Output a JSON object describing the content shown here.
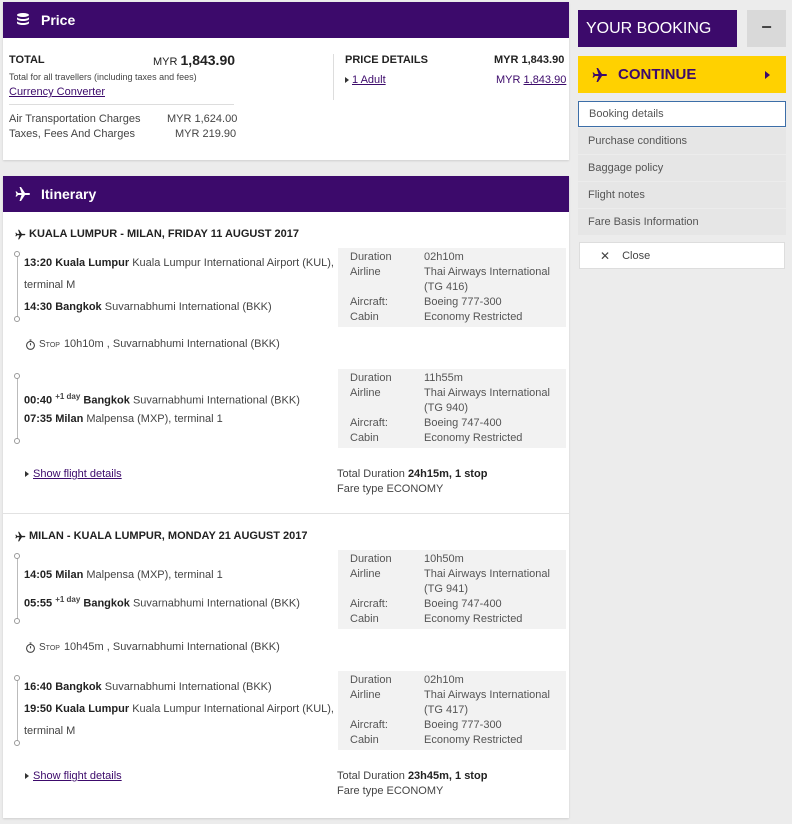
{
  "price": {
    "title": "Price",
    "total_label": "TOTAL",
    "total_currency": "MYR",
    "total_amount": "1,843.90",
    "total_note": "Total for all travellers (including taxes and fees)",
    "currency_converter": "Currency Converter",
    "air_label": "Air Transportation Charges",
    "air_value": "MYR 1,624.00",
    "tax_label": "Taxes, Fees And Charges",
    "tax_value": "MYR 219.90",
    "details_label": "PRICE DETAILS",
    "details_total": "MYR 1,843.90",
    "adult_label": "1 Adult",
    "adult_currency": "MYR",
    "adult_amount": "1,843.90"
  },
  "itinerary": {
    "title": "Itinerary",
    "bounds": [
      {
        "title": "KUALA LUMPUR - MILAN, FRIDAY 11 AUGUST 2017",
        "flights": [
          {
            "dep_time": "13:20",
            "dep_city": "Kuala Lumpur",
            "dep_airport": "Kuala Lumpur International Airport (KUL),",
            "dep_extra": "terminal M",
            "arr_time": "14:30",
            "arr_day": "",
            "arr_city": "Bangkok",
            "arr_airport": "Suvarnabhumi International (BKK)",
            "arr_extra": "",
            "duration": "02h10m",
            "airline": "Thai Airways International",
            "flight_no": "(TG 416)",
            "aircraft": "Boeing 777-300",
            "cabin": "Economy Restricted"
          },
          {
            "dep_time": "00:40",
            "dep_day": "+1 day",
            "dep_city": "Bangkok",
            "dep_airport": "Suvarnabhumi International (BKK)",
            "dep_extra": "",
            "arr_time": "07:35",
            "arr_day": "",
            "arr_city": "Milan",
            "arr_airport": "Malpensa (MXP), terminal 1",
            "arr_extra": "",
            "duration": "11h55m",
            "airline": "Thai Airways International",
            "flight_no": "(TG 940)",
            "aircraft": "Boeing 747-400",
            "cabin": "Economy Restricted"
          }
        ],
        "stop_label": "Stop",
        "stop_text": "10h10m , Suvarnabhumi International (BKK)",
        "show_details": "Show flight details",
        "total_duration_label": "Total Duration",
        "total_duration": "24h15m, 1 stop",
        "fare_type": "Fare type ECONOMY"
      },
      {
        "title": "MILAN - KUALA LUMPUR, MONDAY 21 AUGUST 2017",
        "flights": [
          {
            "dep_time": "14:05",
            "dep_city": "Milan",
            "dep_airport": "Malpensa (MXP), terminal 1",
            "dep_extra": "",
            "arr_time": "05:55",
            "arr_day": "+1 day",
            "arr_city": "Bangkok",
            "arr_airport": "Suvarnabhumi International (BKK)",
            "arr_extra": "",
            "duration": "10h50m",
            "airline": "Thai Airways International",
            "flight_no": "(TG 941)",
            "aircraft": "Boeing 747-400",
            "cabin": "Economy Restricted"
          },
          {
            "dep_time": "16:40",
            "dep_city": "Bangkok",
            "dep_airport": "Suvarnabhumi International (BKK)",
            "dep_extra": "",
            "arr_time": "19:50",
            "arr_day": "",
            "arr_city": "Kuala Lumpur",
            "arr_airport": "Kuala Lumpur International Airport (KUL),",
            "arr_extra": "terminal M",
            "duration": "02h10m",
            "airline": "Thai Airways International",
            "flight_no": "(TG 417)",
            "aircraft": "Boeing 777-300",
            "cabin": "Economy Restricted"
          }
        ],
        "stop_label": "Stop",
        "stop_text": "10h45m , Suvarnabhumi International (BKK)",
        "show_details": "Show flight details",
        "total_duration_label": "Total Duration",
        "total_duration": "23h45m, 1 stop",
        "fare_type": "Fare type ECONOMY"
      }
    ],
    "labels": {
      "duration": "Duration",
      "airline": "Airline",
      "aircraft": "Aircraft:",
      "cabin": "Cabin"
    }
  },
  "sidebar": {
    "title": "YOUR BOOKING",
    "collapse": "−",
    "continue_label": "CONTINUE",
    "items": [
      "Booking details",
      "Purchase conditions",
      "Baggage policy",
      "Flight notes",
      "Fare Basis Information"
    ],
    "close_label": "Close"
  },
  "colors": {
    "primary": "#3c0a6b",
    "accent": "#ffd100"
  }
}
